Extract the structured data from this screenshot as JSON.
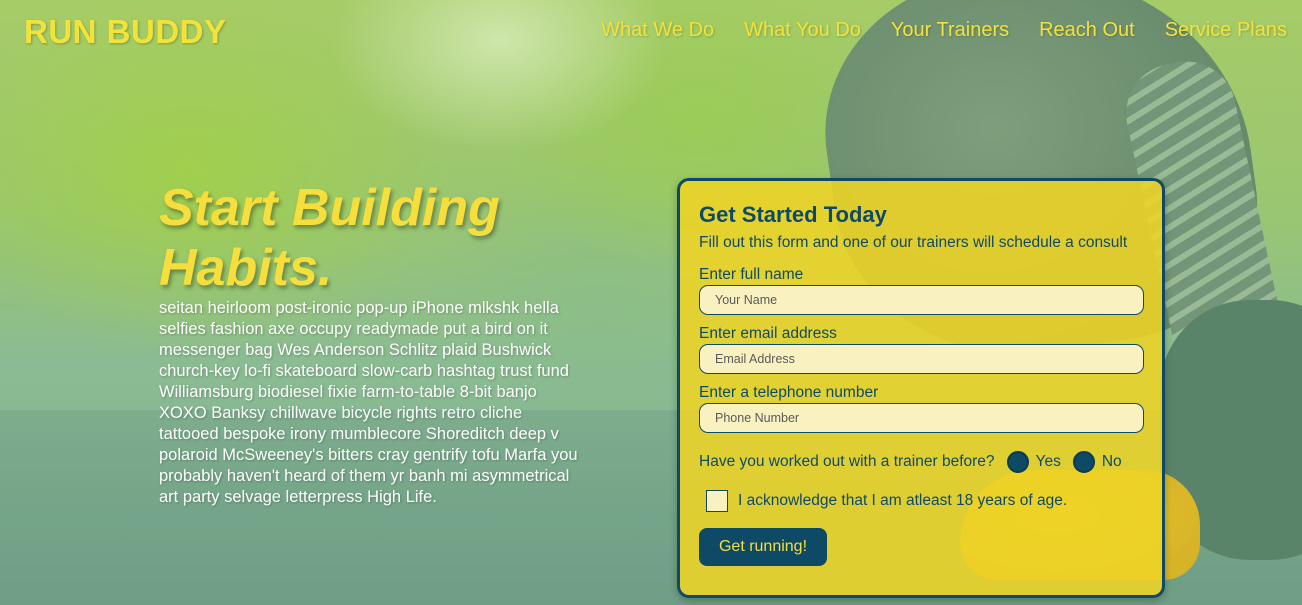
{
  "header": {
    "logo": "RUN BUDDY",
    "nav": [
      {
        "label": "What We Do"
      },
      {
        "label": "What You Do"
      },
      {
        "label": "Your Trainers"
      },
      {
        "label": "Reach Out"
      },
      {
        "label": "Service Plans"
      }
    ]
  },
  "hero": {
    "title_line1": "Start Building",
    "title_line2": "Habits.",
    "body": "seitan heirloom post-ironic pop-up iPhone mlkshk hella selfies fashion axe occupy readymade put a bird on it messenger bag Wes Anderson Schlitz plaid Bushwick church-key lo-fi skateboard slow-carb hashtag trust fund Williamsburg biodiesel fixie farm-to-table 8-bit banjo XOXO Banksy chillwave bicycle rights retro cliche tattooed bespoke irony mumblecore Shoreditch deep v polaroid McSweeney's bitters cray gentrify tofu Marfa you probably haven't heard of them yr banh mi asymmetrical art party selvage letterpress High Life."
  },
  "form": {
    "title": "Get Started Today",
    "subtitle": "Fill out this form and one of our trainers will schedule a consult",
    "name": {
      "label": "Enter full name",
      "placeholder": "Your Name",
      "value": ""
    },
    "email": {
      "label": "Enter email address",
      "placeholder": "Email Address",
      "value": ""
    },
    "phone": {
      "label": "Enter a telephone number",
      "placeholder": "Phone Number",
      "value": ""
    },
    "trainer_question": "Have you worked out with a trainer before?",
    "options": [
      {
        "label": "Yes"
      },
      {
        "label": "No"
      }
    ],
    "acknowledge": "I acknowledge that I am atleast 18 years of age.",
    "submit": "Get running!"
  },
  "colors": {
    "accent_yellow": "#f3e23a",
    "navy": "#0e4a66",
    "card_bg": "#eed426"
  }
}
